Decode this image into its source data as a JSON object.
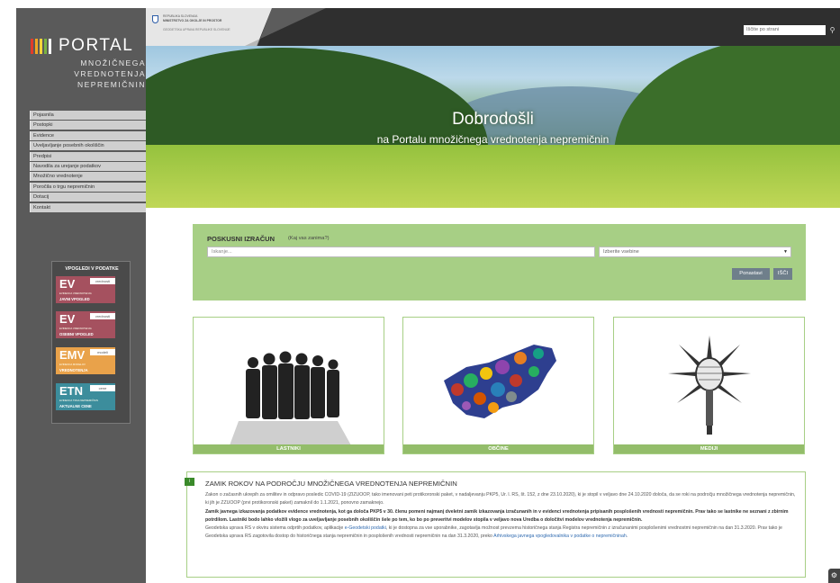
{
  "header": {
    "gov_line1": "REPUBLIKA SLOVENIJA",
    "gov_line2": "MINISTRSTVO ZA OKOLJE IN PROSTOR",
    "gov_line3": "GEODETSKA UPRAVA REPUBLIKE SLOVENIJE",
    "search_placeholder": "Iščite po strani",
    "search_icon": "search-icon"
  },
  "logo": {
    "word": "PORTAL",
    "line1": "MNOŽIČNEGA",
    "line2": "VREDNOTENJA",
    "line3": "NEPREMIČNIN",
    "bar_colors": [
      "#e23b2a",
      "#f2a623",
      "#f7d53b",
      "#7ab342",
      "#ffffff"
    ]
  },
  "sidebar": {
    "items": [
      "Pojasnila",
      "Postopki",
      "Evidence",
      "Uveljavljanje posebnih okoliščin",
      "Predpisi",
      "Navodila za urejanje podatkov",
      "Množično vrednotenje",
      "Poročila o trgu nepremičnin",
      "Dotacij",
      "Kontakt"
    ],
    "vpogledi": {
      "title": "VPOGLEDI V PODATKE",
      "tiles": [
        {
          "code": "EV",
          "tag": "vrednosti",
          "small": "EVIDENCA VREDNOTENJA",
          "big": "JAVNI VPOGLED",
          "color": "#a5515f"
        },
        {
          "code": "EV",
          "tag": "vrednosti",
          "small": "EVIDENCA VREDNOTENJA",
          "big": "OSEBNI VPOGLED",
          "color": "#a5515f"
        },
        {
          "code": "EMV",
          "tag": "modeli",
          "small": "EVIDENCA MODELOV",
          "big": "VREDNOTENJA",
          "color": "#e9a24a"
        },
        {
          "code": "ETN",
          "tag": "cene",
          "small": "EVIDENCA TRGA NEPREMIČNIN",
          "big": "AKTUALNE CENE",
          "color": "#3c8d9c"
        }
      ]
    }
  },
  "hero": {
    "title": "Dobrodošli",
    "subtitle": "na Portalu množičnega vrednotenja nepremičnin"
  },
  "calc": {
    "title": "POSKUSNI IZRAČUN",
    "hint": "(Kaj vas zanima?)",
    "input_placeholder": "Iskanje...",
    "select_value": "Izberite vsebine",
    "reset_label": "Ponastavi",
    "search_label": "IŠČI"
  },
  "cards": [
    {
      "label": "LASTNIKI",
      "icon": "people-silhouettes-icon"
    },
    {
      "label": "OBČINE",
      "icon": "slovenia-municipalities-map-icon"
    },
    {
      "label": "MEDIJI",
      "icon": "microphone-icon"
    }
  ],
  "notice": {
    "badge": "i",
    "title": "ZAMIK ROKOV NA PODROČJU MNOŽIČNEGA VREDNOTENJA NEPREMIČNIN",
    "p1": "Zakon o začasnih ukrepih za omilitev in odpravo posledic COVID-19 (ZIZUOOP, tako imenovani peti protikoronski paket, v nadaljevanju PKP5, Ur. l. RS, št. 152, z dne 23.10.2020), ki je stopil v veljavo dne 24.10.2020 določa, da se roki na področju množičnega vrednotenja nepremičnin, ki jih je ZZUOOP (prvi protikoronski paket) zamaknil do 1.1.2021, ponovno zamaknejo.",
    "p2": "Zamik javnega izkazovanja podatkov evidence vrednotenja, kot ga določa PKP5 v 30. členu pomeni najmanj dveletni zamik izkazovanja izračunanih in v evidenci vrednotenja pripisanih posplošenih vrednosti nepremičnin. Prav tako se lastnike ne seznani z zbirnim potrdilom. Lastniki bodo lahko vložili vlogo za uveljavljanje posebnih okoliščin šele po tem, ko bo po preveritvi modelov stopila v veljavo nova Uredba o določitvi modelov vrednotenja nepremičnin.",
    "p3a": "Geodetska uprava RS v okviru sistema odprtih podatkov, aplikacije ",
    "p3_link1": "e-Geodetski podatki",
    "p3b": ", ki je dostopna za vse uporabnike, zagotavlja možnost prevzema historičnega stanja Registra nepremičnin z izračunanimi posplošenimi vrednostmi nepremičnin na dan 31.3.2020. Prav tako je Geodetska uprava RS zagotovila dostop do historičnega stanja nepremičnin in posplošenih vrednosti nepremičnin na dan 31.3.2020, preko ",
    "p3_link2": "Arhivskega javnega vpogledovalnika v podatke o nepremičninah",
    "p3c": "."
  },
  "corner": {
    "glyph": "⚙"
  }
}
